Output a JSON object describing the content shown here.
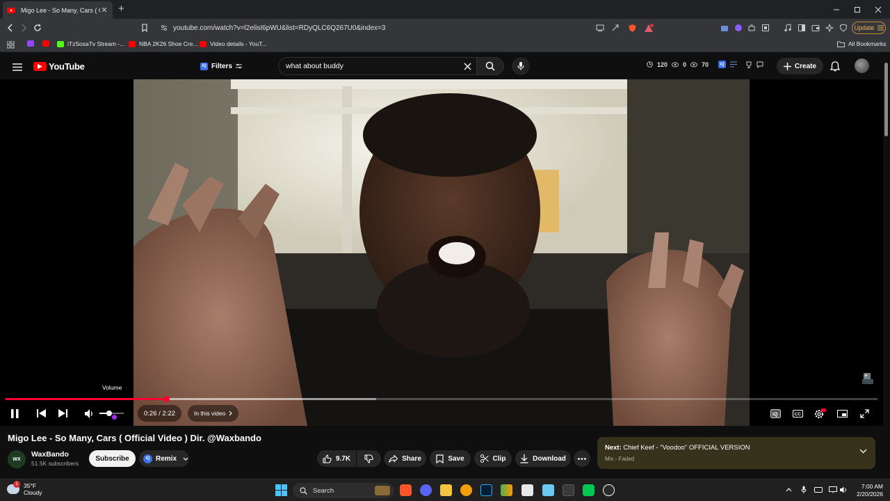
{
  "browser": {
    "tab_title": "Migo Lee - So Many, Cars ( O",
    "new_tab": "+",
    "url": "youtube.com/watch?v=l2elisI6pWU&list=RDyQLC6Q267U0&index=3",
    "update_label": "Update",
    "bookmarks": [
      {
        "label": "",
        "color": "#9146ff"
      },
      {
        "label": "",
        "color": "#ff0000"
      },
      {
        "label": "iTzSosaTv Stream -...",
        "color": "#53fc18"
      },
      {
        "label": "NBA 2K26 Shoe Cre...",
        "color": "#ff0000"
      },
      {
        "label": "Video details - YouT...",
        "color": "#ff0000"
      }
    ],
    "all_bookmarks": "All Bookmarks"
  },
  "youtube": {
    "logo_text": "YouTube",
    "filters_label": "Filters",
    "search_query": "what about buddy",
    "stats": {
      "views": "120",
      "likes": "0",
      "dislikes": "70"
    },
    "create_label": "Create"
  },
  "player": {
    "volume_tooltip": "Volume",
    "current_time": "0:26",
    "separator": " / ",
    "duration": "2:22",
    "chapter_label": "In this video",
    "progress_fraction": 0.185,
    "buffered_fraction": 0.425,
    "volume_fraction": 0.4
  },
  "video": {
    "title": "Migo Lee - So Many, Cars ( Official Video ) Dir. @Waxbando",
    "channel_name": "WaxBando",
    "channel_avatar_text": "WX",
    "subscribers": "51.5K subscribers",
    "subscribe_label": "Subscribe",
    "remix_label": "Remix",
    "likes": "9.7K",
    "share_label": "Share",
    "save_label": "Save",
    "clip_label": "Clip",
    "download_label": "Download"
  },
  "up_next": {
    "prefix": "Next: ",
    "title": "Chief Keef - \"Voodoo\" OFFICIAL VERSION",
    "subtitle": "Mix - Faded"
  },
  "taskbar": {
    "temperature": "35°F",
    "condition": "Cloudy",
    "weather_badge": "1",
    "search_label": "Search",
    "time": "7:00 AM",
    "date": "2/20/2026"
  },
  "colors": {
    "accent_red": "#ff0033",
    "next_panel": "#36321c",
    "update_orange": "#f0b45a"
  }
}
